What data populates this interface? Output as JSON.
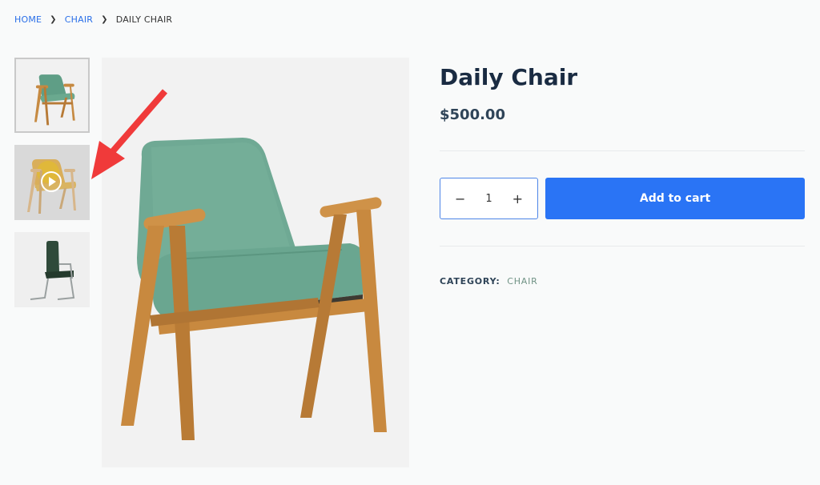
{
  "breadcrumb": {
    "items": [
      {
        "label": "HOME",
        "link": true
      },
      {
        "label": "CHAIR",
        "link": true
      },
      {
        "label": "DAILY CHAIR",
        "link": false
      }
    ],
    "separator_icon": "chevron-right-icon"
  },
  "gallery": {
    "thumbnails": [
      {
        "name": "green-armchair-thumbnail",
        "type": "image",
        "selected": true
      },
      {
        "name": "yellow-armchair-video-thumbnail",
        "type": "video",
        "icon": "play-icon"
      },
      {
        "name": "dark-green-office-chair-thumbnail",
        "type": "image"
      }
    ],
    "main_image": "green-armchair",
    "annotation": "red-arrow-pointing-at-video-thumbnail"
  },
  "product": {
    "title": "Daily Chair",
    "price": "$500.00",
    "quantity": {
      "decrement": "−",
      "value": "1",
      "increment": "+"
    },
    "add_to_cart_label": "Add to cart",
    "category_label": "CATEGORY:",
    "category_value": "CHAIR"
  },
  "colors": {
    "accent": "#2a74f5",
    "link": "#2a6fe8",
    "title": "#1a2b42",
    "annotation": "#f03a3a"
  }
}
